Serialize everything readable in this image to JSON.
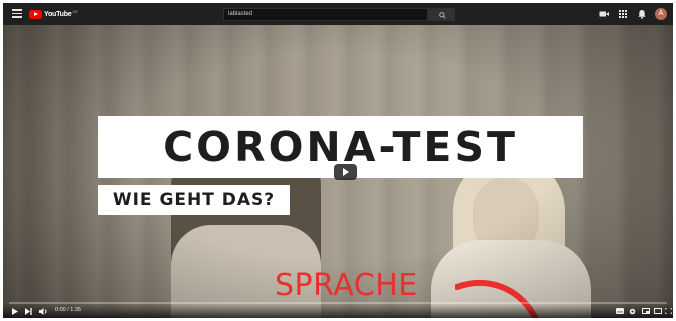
{
  "header": {
    "logo_text": "YouTube",
    "logo_sup": "DE",
    "search": {
      "value": "lablasted"
    },
    "user_initial": "A"
  },
  "video": {
    "overlay_title": "CORONA-TEST",
    "overlay_subtitle": "WIE GEHT DAS?",
    "overlay_sprache": "SPRACHE",
    "accent_color": "#e8302c"
  },
  "player": {
    "time": "0:00 / 1:35",
    "progress": 0.0
  },
  "icons": {
    "menu": "menu-icon",
    "search": "search-icon",
    "create": "video-camera-icon",
    "apps": "apps-grid-icon",
    "notifications": "bell-icon",
    "play": "play-icon",
    "next": "next-icon",
    "volume": "volume-icon",
    "subtitles": "subtitles-icon",
    "settings": "gear-icon",
    "miniplayer": "miniplayer-icon",
    "theater": "theater-icon",
    "fullscreen": "fullscreen-icon"
  }
}
